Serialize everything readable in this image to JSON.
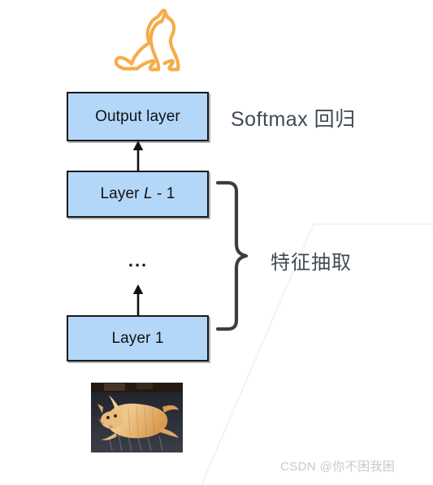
{
  "diagram": {
    "title_icon": "cat-outline-icon",
    "boxes": [
      {
        "id": "output",
        "label": "Output layer"
      },
      {
        "id": "layer_L_minus_1",
        "label_prefix": "Layer ",
        "label_italic": "L",
        "label_suffix": " - 1"
      },
      {
        "id": "ellipsis",
        "label": "..."
      },
      {
        "id": "layer_1",
        "label": "Layer 1"
      }
    ],
    "annotations": [
      {
        "id": "softmax",
        "text": "Softmax 回归"
      },
      {
        "id": "feature_extraction",
        "text": "特征抽取"
      }
    ],
    "input_image": {
      "alt": "orange tabby cat lying on dark floor"
    },
    "watermark": "CSDN @你不困我困"
  },
  "colors": {
    "box_fill": "#b3d7f9",
    "box_border": "#1a1a1a",
    "cat_icon": "#f5ad4a",
    "annotation_text": "#3f4a56",
    "brace": "#3d3d3d",
    "watermark": "#c9c9cc",
    "bg_line": "#f0f0f0"
  }
}
